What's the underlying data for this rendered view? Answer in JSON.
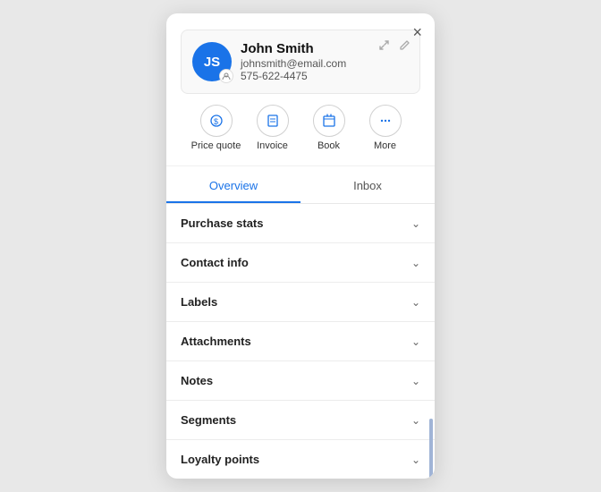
{
  "modal": {
    "close_label": "×"
  },
  "profile": {
    "initials": "JS",
    "name": "John Smith",
    "email": "johnsmith@email.com",
    "phone": "575-622-4475",
    "expand_icon": "⤢",
    "edit_icon": "✎"
  },
  "actions": [
    {
      "id": "price-quote",
      "label": "Price quote",
      "icon": "$"
    },
    {
      "id": "invoice",
      "label": "Invoice",
      "icon": "📄"
    },
    {
      "id": "book",
      "label": "Book",
      "icon": "📅"
    },
    {
      "id": "more",
      "label": "More",
      "icon": "···"
    }
  ],
  "tabs": [
    {
      "id": "overview",
      "label": "Overview",
      "active": true
    },
    {
      "id": "inbox",
      "label": "Inbox",
      "active": false
    }
  ],
  "accordion": [
    {
      "id": "purchase-stats",
      "label": "Purchase stats"
    },
    {
      "id": "contact-info",
      "label": "Contact info"
    },
    {
      "id": "labels",
      "label": "Labels"
    },
    {
      "id": "attachments",
      "label": "Attachments"
    },
    {
      "id": "notes",
      "label": "Notes"
    },
    {
      "id": "segments",
      "label": "Segments"
    },
    {
      "id": "loyalty-points",
      "label": "Loyalty points"
    }
  ]
}
